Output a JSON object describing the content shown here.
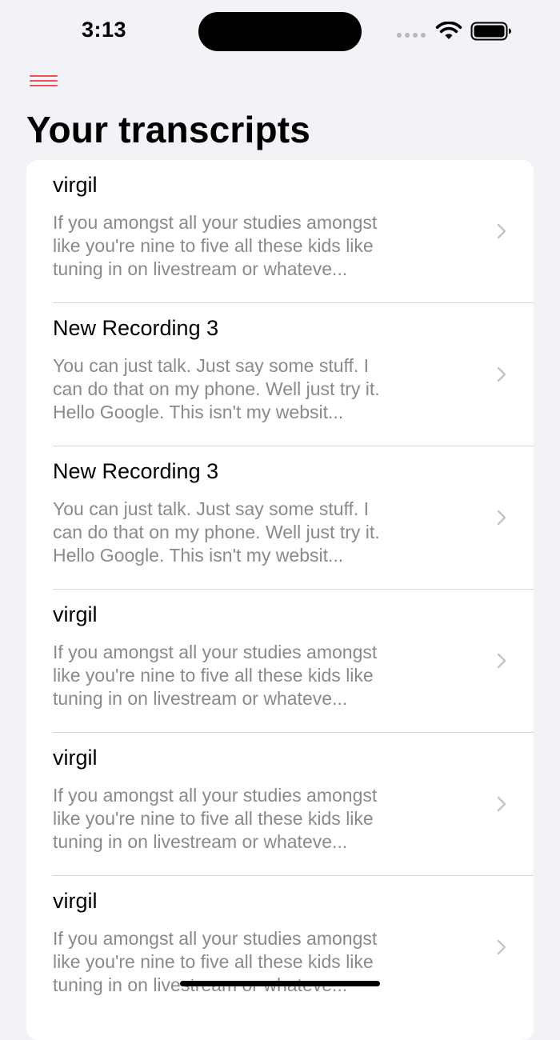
{
  "status_bar": {
    "time": "3:13"
  },
  "header": {
    "menu_icon": "hamburger-menu-icon",
    "title": "Your transcripts"
  },
  "colors": {
    "accent": "#f0505a",
    "background": "#f2f2f7",
    "card": "#ffffff",
    "secondary_text": "#8a8a8e"
  },
  "transcripts": [
    {
      "title": "virgil",
      "preview_lines": [
        "If you amongst all your studies amongst",
        "like you're nine to five all these kids like",
        "tuning in on livestream or whateve..."
      ]
    },
    {
      "title": "New Recording 3",
      "preview_lines": [
        "You can just talk. Just say some stuff. I",
        "can do that on my phone. Well just try it.",
        "Hello Google. This isn't my websit..."
      ]
    },
    {
      "title": "New Recording 3",
      "preview_lines": [
        "You can just talk. Just say some stuff. I",
        "can do that on my phone. Well just try it.",
        "Hello Google. This isn't my websit..."
      ]
    },
    {
      "title": "virgil",
      "preview_lines": [
        "If you amongst all your studies amongst",
        "like you're nine to five all these kids like",
        "tuning in on livestream or whateve..."
      ]
    },
    {
      "title": "virgil",
      "preview_lines": [
        "If you amongst all your studies amongst",
        "like you're nine to five all these kids like",
        "tuning in on livestream or whateve..."
      ]
    },
    {
      "title": "virgil",
      "preview_lines": [
        "If you amongst all your studies amongst",
        "like you're nine to five all these kids like",
        "tuning in on livestream or whateve..."
      ]
    }
  ]
}
